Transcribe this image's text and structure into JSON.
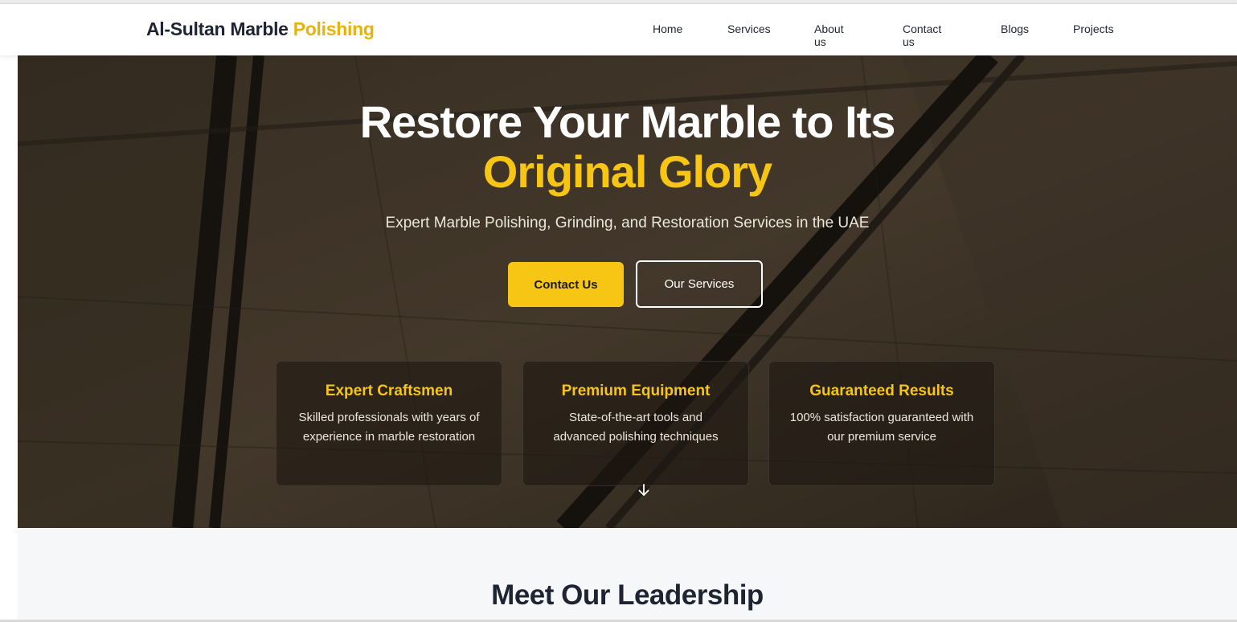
{
  "brand": {
    "name_main": "Al-Sultan Marble",
    "name_accent": "Polishing"
  },
  "nav": {
    "items": [
      "Home",
      "Services",
      "About us",
      "Contact us",
      "Blogs",
      "Projects"
    ]
  },
  "hero": {
    "title_line1": "Restore Your Marble to Its",
    "title_line2": "Original Glory",
    "subtitle": "Expert Marble Polishing, Grinding, and Restoration Services in the UAE",
    "primary_button": "Contact Us",
    "secondary_button": "Our Services",
    "scroll_icon": "arrow-down-icon"
  },
  "features": [
    {
      "title": "Expert Craftsmen",
      "text": "Skilled professionals with years of experience in marble restoration"
    },
    {
      "title": "Premium Equipment",
      "text": "State-of-the-art tools and advanced polishing techniques"
    },
    {
      "title": "Guaranteed Results",
      "text": "100% satisfaction guaranteed with our premium service"
    }
  ],
  "leadership": {
    "heading": "Meet Our Leadership"
  },
  "colors": {
    "accent": "#f7c514",
    "dark": "#1f2433"
  }
}
